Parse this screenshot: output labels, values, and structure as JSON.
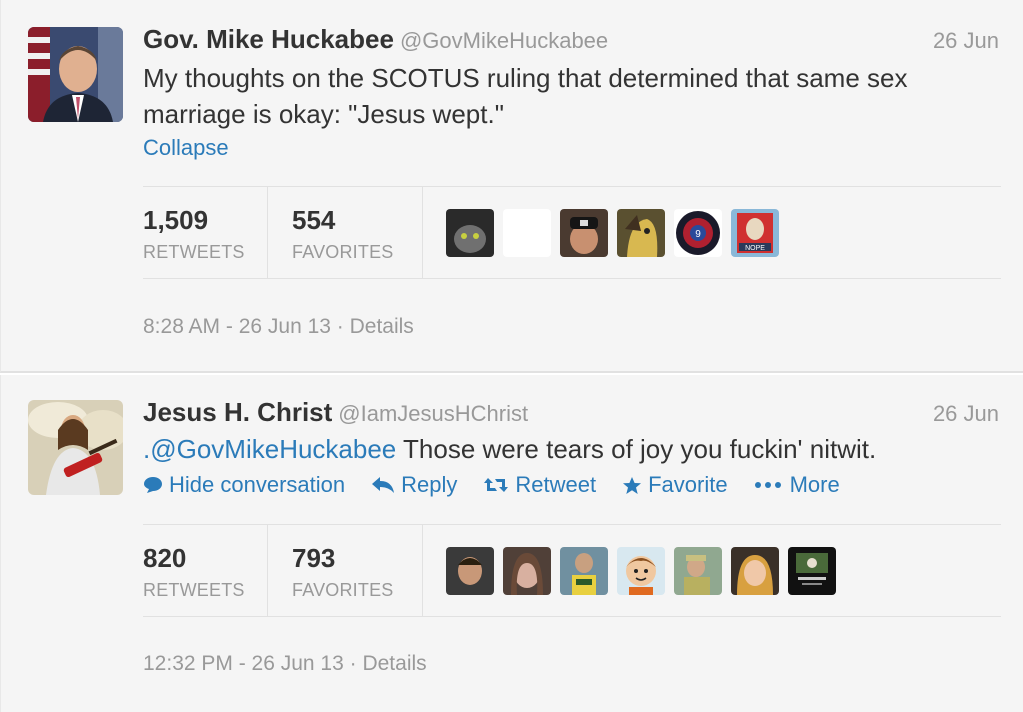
{
  "tweets": [
    {
      "name": "Gov. Mike Huckabee",
      "handle": "@GovMikeHuckabee",
      "date": "26 Jun",
      "text": "My thoughts on the SCOTUS ruling that determined that same sex marriage is okay:  \"Jesus wept.\"",
      "collapse_label": "Collapse",
      "retweets": "1,509",
      "retweets_label": "RETWEETS",
      "favorites": "554",
      "favorites_label": "FAVORITES",
      "timestamp": "8:28 AM - 26 Jun 13 · Details"
    },
    {
      "name": "Jesus H. Christ",
      "handle": "@IamJesusHChrist",
      "date": "26 Jun",
      "mention": ".@GovMikeHuckabee",
      "text": " Those were tears of joy you fuckin' nitwit.",
      "actions": {
        "hide": "Hide conversation",
        "reply": "Reply",
        "retweet": "Retweet",
        "favorite": "Favorite",
        "more": "More"
      },
      "retweets": "820",
      "retweets_label": "RETWEETS",
      "favorites": "793",
      "favorites_label": "FAVORITES",
      "timestamp": "12:32 PM - 26 Jun 13 · Details"
    }
  ],
  "colors": {
    "link": "#2b7bb9",
    "muted": "#999999",
    "background": "#f5f5f5"
  }
}
